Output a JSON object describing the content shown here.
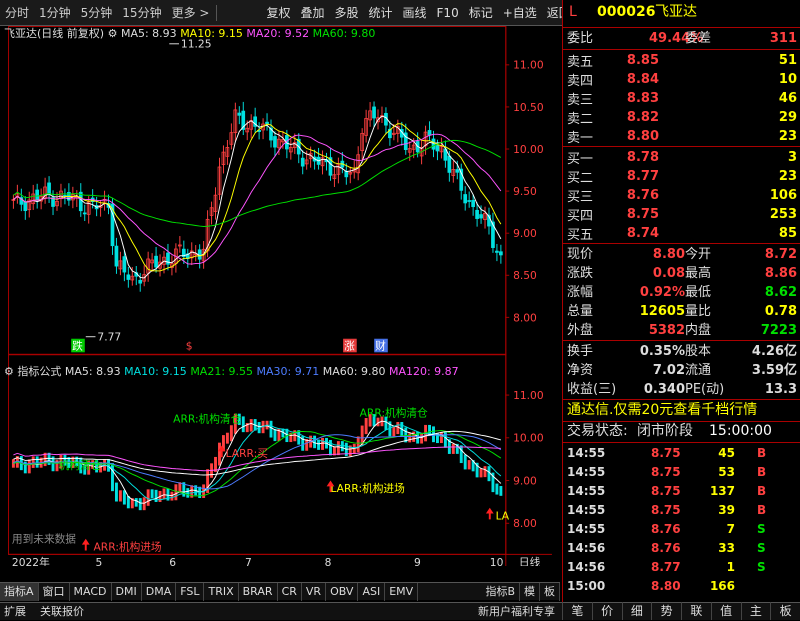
{
  "toolbar": {
    "left_items": [
      "分时",
      "1分钟",
      "5分钟",
      "15分钟",
      "更多 >"
    ],
    "right_items": [
      "复权",
      "叠加",
      "多股",
      "统计",
      "画线",
      "F10",
      "标记",
      "+自选",
      "返回"
    ]
  },
  "main_chart": {
    "title_name": "飞亚达(日线 前复权)",
    "ma5": "MA5: 8.93",
    "ma10": "MA10: 9.15",
    "ma20": "MA20: 9.52",
    "ma60": "MA60: 9.80",
    "high_label": "11.25",
    "low_label": "7.77",
    "y_ticks": [
      "11.00",
      "10.50",
      "10.00",
      "9.50",
      "9.00",
      "8.50",
      "8.00"
    ],
    "markers": [
      "跌",
      "$",
      "涨",
      "财"
    ]
  },
  "sub_chart": {
    "title_name": "指标公式",
    "ma5": "MA5: 8.93",
    "ma10": "MA10: 9.15",
    "ma21": "MA21: 9.55",
    "ma30": "MA30: 9.71",
    "ma60": "MA60: 9.80",
    "ma120": "MA120: 9.87",
    "y_ticks": [
      "11.00",
      "10.00",
      "9.00",
      "8.00"
    ],
    "annotations": [
      "ARR:机构清仓",
      "LARR:买",
      "LARR:机构进场",
      "ARR:机构清仓",
      "机构清仓",
      "ARR:机构进场",
      "LA"
    ],
    "warning": "用到未来数据"
  },
  "x_axis": [
    "2022年",
    "5",
    "6",
    "7",
    "8",
    "9",
    "10"
  ],
  "x_axis_right": "日线",
  "tabs": [
    "指标A",
    "窗口",
    "MACD",
    "DMI",
    "DMA",
    "FSL",
    "TRIX",
    "BRAR",
    "CR",
    "VR",
    "OBV",
    "ASI",
    "EMV"
  ],
  "tabs_right": [
    "指标B",
    "模",
    "板"
  ],
  "status_bar": {
    "left1": "扩展",
    "left2": "关联报价",
    "right": "新用户福利专享"
  },
  "stock": {
    "flag": "L",
    "code": "000026",
    "name": "飞亚达",
    "weibi_label": "委比",
    "weibi": "49.44%",
    "weicha_label": "委差",
    "weicha": "311"
  },
  "sell": [
    {
      "label": "卖五",
      "price": "8.85",
      "vol": "51"
    },
    {
      "label": "卖四",
      "price": "8.84",
      "vol": "10"
    },
    {
      "label": "卖三",
      "price": "8.83",
      "vol": "46"
    },
    {
      "label": "卖二",
      "price": "8.82",
      "vol": "29"
    },
    {
      "label": "卖一",
      "price": "8.80",
      "vol": "23"
    }
  ],
  "buy": [
    {
      "label": "买一",
      "price": "8.78",
      "vol": "3"
    },
    {
      "label": "买二",
      "price": "8.77",
      "vol": "23"
    },
    {
      "label": "买三",
      "price": "8.76",
      "vol": "106"
    },
    {
      "label": "买四",
      "price": "8.75",
      "vol": "253"
    },
    {
      "label": "买五",
      "price": "8.74",
      "vol": "85"
    }
  ],
  "quote": [
    {
      "l1": "现价",
      "v1": "8.80",
      "l2": "今开",
      "v2": "8.72"
    },
    {
      "l1": "涨跌",
      "v1": "0.08",
      "l2": "最高",
      "v2": "8.86"
    },
    {
      "l1": "涨幅",
      "v1": "0.92%",
      "l2": "最低",
      "v2": "8.62"
    },
    {
      "l1": "总量",
      "v1": "12605",
      "l2": "量比",
      "v2": "0.78"
    },
    {
      "l1": "外盘",
      "v1": "5382",
      "l2": "内盘",
      "v2": "7223"
    }
  ],
  "fundamentals": [
    {
      "l1": "换手",
      "v1": "0.35%",
      "l2": "股本",
      "v2": "4.26亿"
    },
    {
      "l1": "净资",
      "v1": "7.02",
      "l2": "流通",
      "v2": "3.59亿"
    },
    {
      "l1": "收益(三)",
      "v1": "0.340",
      "l2": "PE(动)",
      "v2": "13.3"
    }
  ],
  "ad_banner": "通达信.仅需20元查看千档行情",
  "trade_state_label": "交易状态:",
  "trade_state": "闭市阶段",
  "trade_time": "15:00:00",
  "ticks": [
    {
      "t": "14:55",
      "p": "8.75",
      "v": "45",
      "d": "B"
    },
    {
      "t": "14:55",
      "p": "8.75",
      "v": "53",
      "d": "B"
    },
    {
      "t": "14:55",
      "p": "8.75",
      "v": "137",
      "d": "B"
    },
    {
      "t": "14:55",
      "p": "8.75",
      "v": "39",
      "d": "B"
    },
    {
      "t": "14:55",
      "p": "8.76",
      "v": "7",
      "d": "S"
    },
    {
      "t": "14:56",
      "p": "8.76",
      "v": "33",
      "d": "S"
    },
    {
      "t": "14:56",
      "p": "8.77",
      "v": "1",
      "d": "S"
    },
    {
      "t": "15:00",
      "p": "8.80",
      "v": "166",
      "d": ""
    }
  ],
  "bottom_nav": [
    "笔",
    "价",
    "细",
    "势",
    "联",
    "值",
    "主",
    "板"
  ],
  "colors": {
    "up": "#ff4040",
    "down": "#00e0e0",
    "border": "#aa0000",
    "vol": "#ffff00"
  }
}
